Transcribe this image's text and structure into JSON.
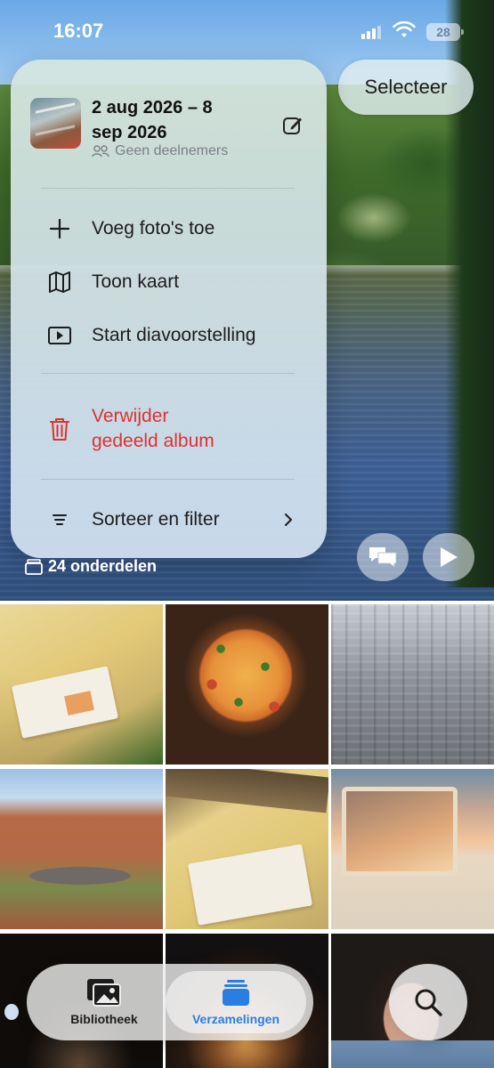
{
  "status_bar": {
    "time": "16:07",
    "battery": "28"
  },
  "header": {
    "select_label": "Selecteer"
  },
  "album": {
    "title_line1": "2 aug 2026 – 8",
    "title_line2": "sep 2026",
    "participants": "Geen deelnemers"
  },
  "menu": {
    "items": [
      {
        "label": "Voeg foto's toe",
        "icon": "plus-icon"
      },
      {
        "label": "Toon kaart",
        "icon": "map-icon"
      },
      {
        "label": "Start diavoorstelling",
        "icon": "slideshow-icon"
      }
    ],
    "delete_line1": "Verwijder",
    "delete_line2": "gedeeld album",
    "sort_label": "Sorteer en filter"
  },
  "item_count": "24 onderdelen",
  "tabbar": {
    "library_label": "Bibliotheek",
    "collections_label": "Verzamelingen"
  },
  "colors": {
    "accent": "#2a7de1",
    "danger": "#e0312f"
  }
}
